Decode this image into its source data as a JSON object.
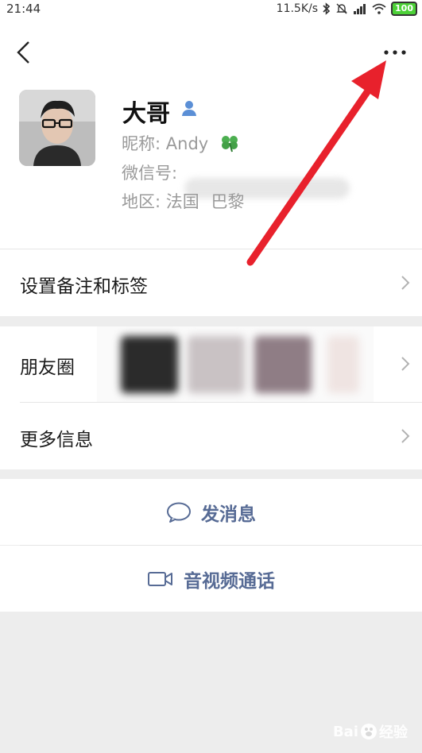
{
  "status_bar": {
    "time": "21:44",
    "speed": "11.5K/s",
    "battery": "100"
  },
  "profile": {
    "name": "大哥",
    "nickname_label": "昵称:",
    "nickname_value": "Andy",
    "wechat_id_label": "微信号:",
    "region_label": "地区:",
    "region_country": "法国",
    "region_city": "巴黎"
  },
  "menu": {
    "remark_label": "设置备注和标签",
    "moments_label": "朋友圈",
    "more_info_label": "更多信息"
  },
  "actions": {
    "message_label": "发消息",
    "call_label": "音视频通话"
  },
  "watermark": {
    "text": "Bai",
    "suffix": "经验"
  },
  "colors": {
    "accent_link": "#576b95",
    "arrow_red": "#e8212c",
    "background": "#ededed"
  }
}
